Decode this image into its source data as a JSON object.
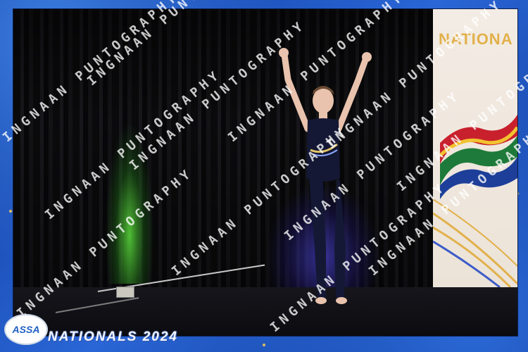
{
  "banner": {
    "text": "NATIONA"
  },
  "footer": {
    "logo_text": "ASSA",
    "event_title": "NATIONALS 2024"
  },
  "watermark": {
    "text": "INGNAAN PUNTOGRAPHY"
  },
  "colors": {
    "frame_blue": "#1b4fb8",
    "gold": "#e2b14c",
    "stage_green": "#5adc3c",
    "stage_blue": "#5a50ff"
  },
  "icons": [
    "assa-logo-icon",
    "south-africa-flag-icon"
  ]
}
